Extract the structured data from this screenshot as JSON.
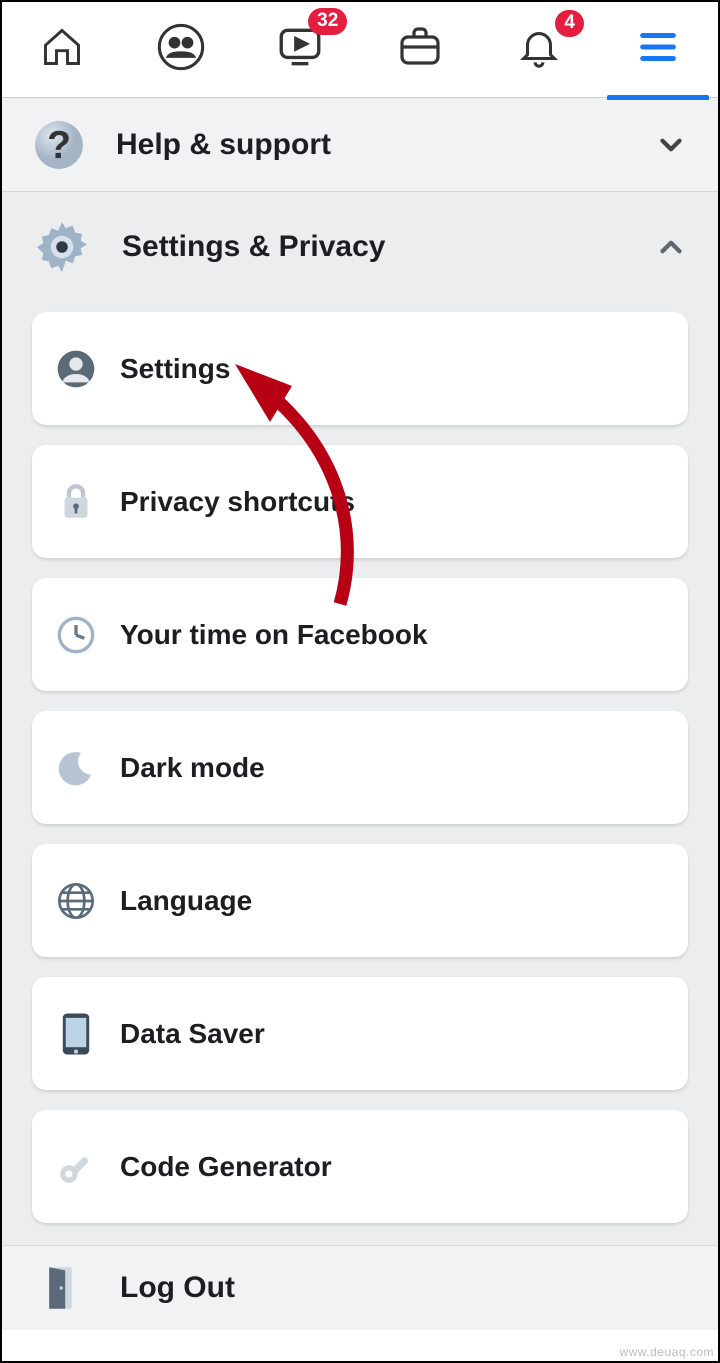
{
  "nav": {
    "videos_badge": "32",
    "notifications_badge": "4"
  },
  "sections": {
    "help": {
      "title": "Help & support"
    },
    "settings": {
      "title": "Settings & Privacy",
      "items": [
        {
          "label": "Settings"
        },
        {
          "label": "Privacy shortcuts"
        },
        {
          "label": "Your time on Facebook"
        },
        {
          "label": "Dark mode"
        },
        {
          "label": "Language"
        },
        {
          "label": "Data Saver"
        },
        {
          "label": "Code Generator"
        }
      ]
    }
  },
  "logout": {
    "label": "Log Out"
  },
  "watermark": "www.deuaq.com"
}
